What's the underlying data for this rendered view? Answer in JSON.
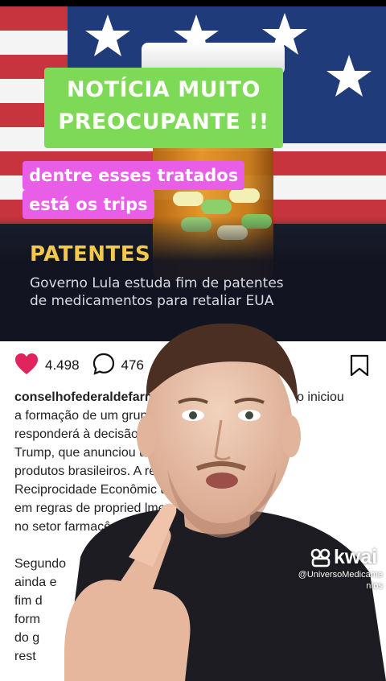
{
  "news_card": {
    "headline_lines": [
      "NOTÍCIA MUITO",
      "PREOCUPANTE  !!"
    ],
    "note_lines": [
      "dentre esses tratados",
      "está os trips"
    ],
    "section": "PATENTES",
    "summary_lines": [
      "Governo Lula estuda fim de patentes",
      "de medicamentos para retaliar EUA"
    ]
  },
  "post": {
    "likes": "4.498",
    "comments": "476",
    "icons": {
      "like": "heart-icon",
      "comment": "comment-icon",
      "share": "send-icon",
      "save": "bookmark-icon"
    },
    "caption_username": "conselhofederaldefarm",
    "caption_lines": [
      "o iniciou",
      "a formação de um grupo                        mo",
      "responderá à decisão d                      Donald",
      "Trump, que anunciou um                    obre",
      "produtos brasileiros. A re                  ela Lei de",
      "Reciprocidade Econômic                  udanças",
      "em regras de propried                      lmente",
      "no setor farmacêutic"
    ],
    "caption_lines_2": [
      "Segundo",
      "ainda e",
      "fim d",
      "form",
      "do g",
      "rest"
    ]
  },
  "watermark": {
    "brand": "kwai",
    "handle_lines": [
      "@UniversoMedicame",
      "ntos"
    ]
  },
  "colors": {
    "heart": "#e0245e",
    "headline_bg": "#7ed957",
    "note_bg": "#e95ee6",
    "section": "#f2c94c"
  }
}
